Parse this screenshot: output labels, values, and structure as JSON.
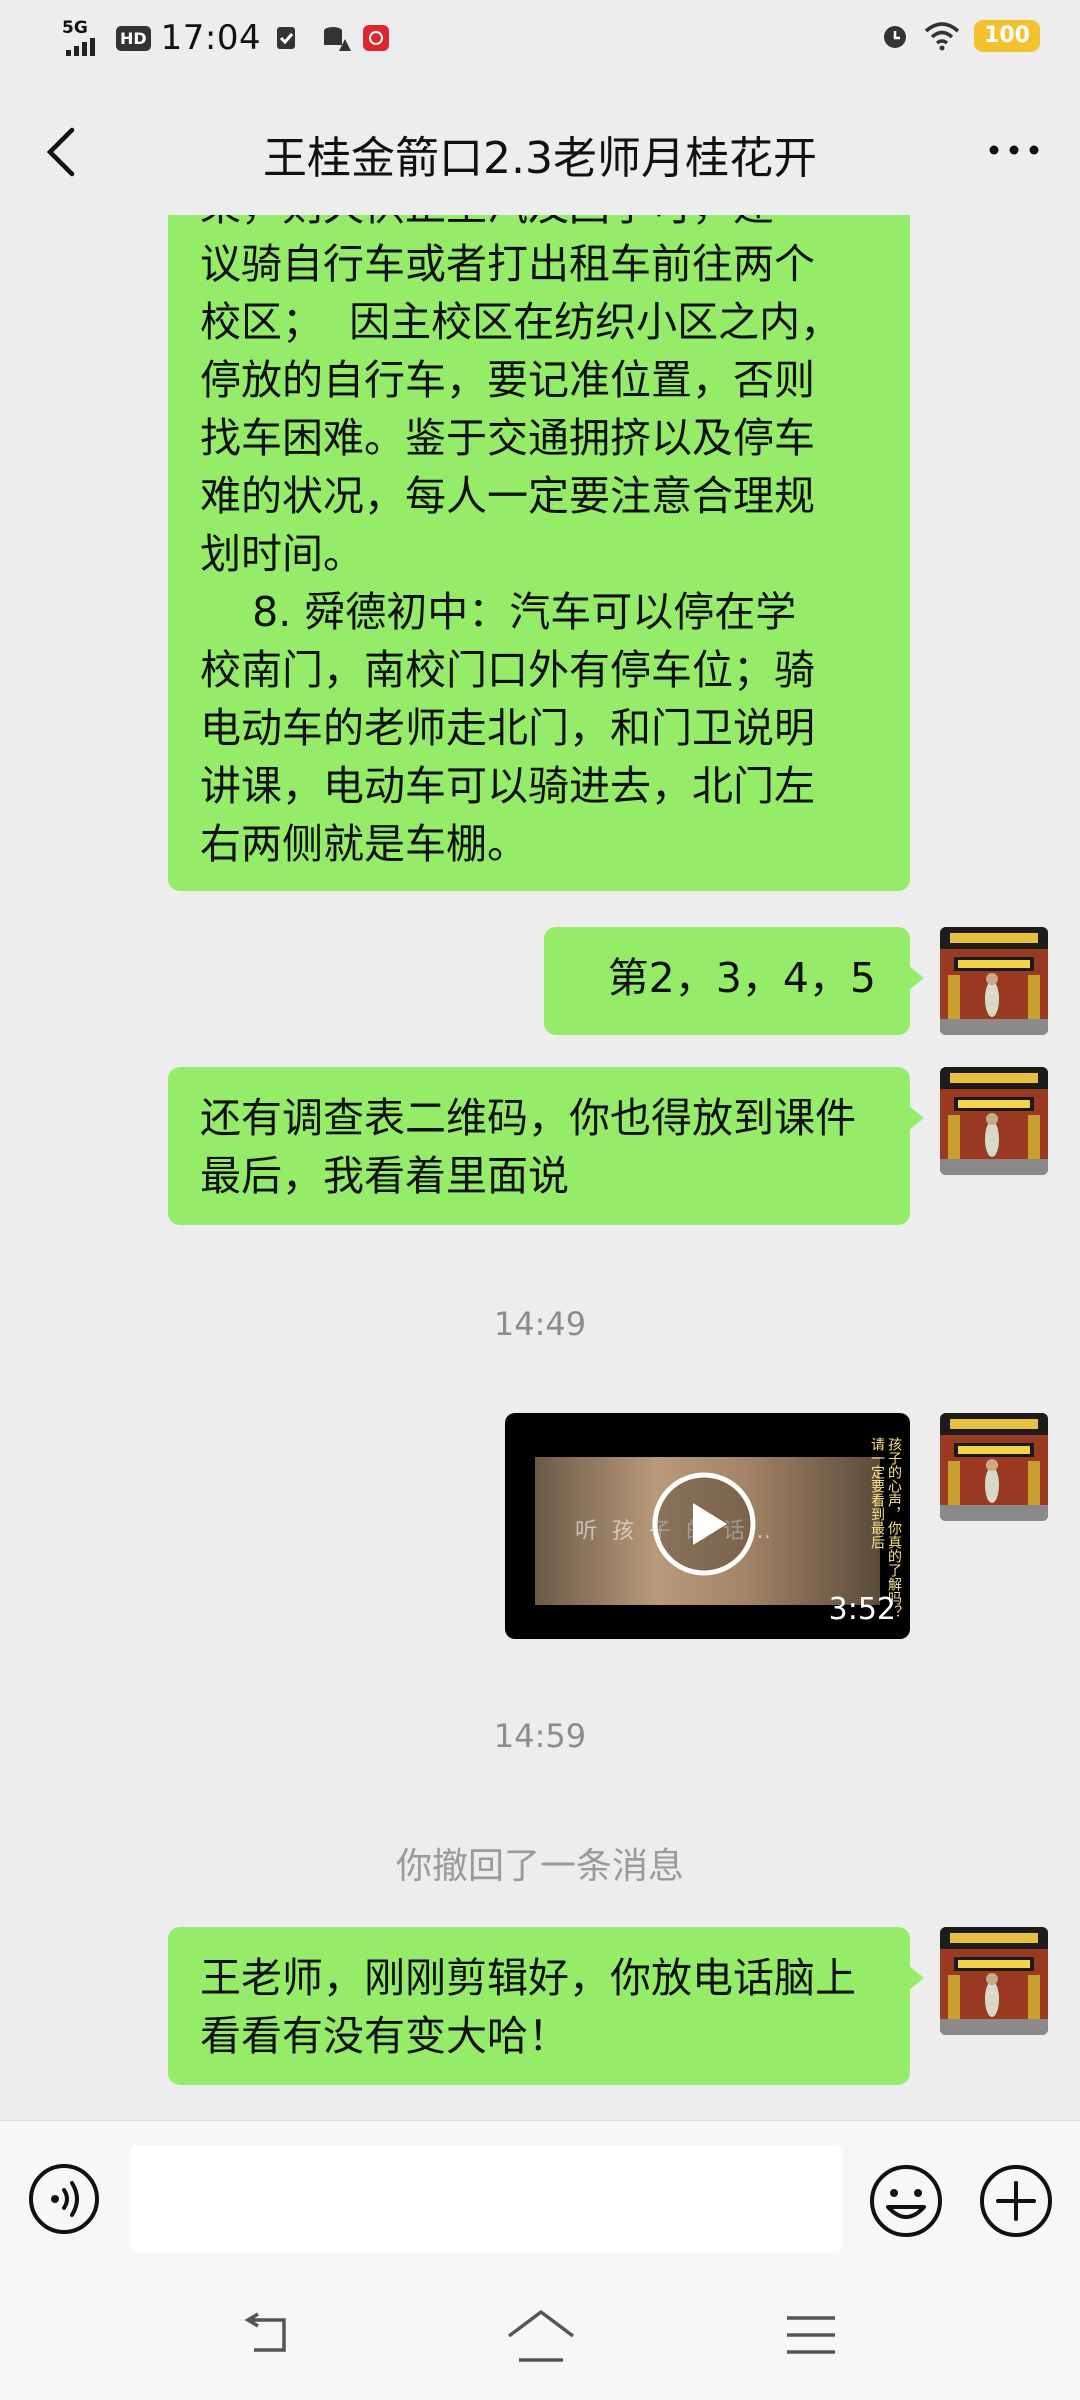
{
  "status_bar": {
    "network": "5G",
    "hd": "HD",
    "time": "17:04",
    "battery": "100",
    "icons": [
      "signal-5g-icon",
      "hd-icon",
      "check-shield-icon",
      "data-warning-icon",
      "app-badge-icon",
      "alarm-icon",
      "wifi-icon",
      "battery-icon"
    ]
  },
  "header": {
    "title": "王桂金箭口2.3老师月桂花开",
    "back_icon": "chevron-left-icon",
    "more_icon": "more-dots-icon"
  },
  "messages": [
    {
      "id": "msg1",
      "sender": "other",
      "text": "乘，则天供正坐汽及回学可，建\n议骑自行车或者打出租车前往两个\n校区；  因主校区在纺织小区之内，\n停放的自行车，要记准位置，否则\n找车困难。鉴于交通拥挤以及停车\n难的状况，每人一定要注意合理规\n划时间。\n    8. 舜德初中：汽车可以停在学\n校南门，南校门口外有停车位；骑\n电动车的老师走北门，和门卫说明\n讲课，电动车可以骑进去，北门左\n右两侧就是车棚。"
    },
    {
      "id": "msg2",
      "sender": "me",
      "text": "第2，3，4，5"
    },
    {
      "id": "msg3",
      "sender": "me",
      "text": "还有调查表二维码，你也得放到课件最后，我看着里面说"
    },
    {
      "id": "ts1",
      "type": "timestamp",
      "text": "14:49"
    },
    {
      "id": "video1",
      "type": "video",
      "sender": "me",
      "duration": "3:52",
      "overlay_text": "听 孩 子 的 话…",
      "side_text": "孩子的心声，你真的了解吗？请一定要看到最后"
    },
    {
      "id": "ts2",
      "type": "timestamp",
      "text": "14:59"
    },
    {
      "id": "sys1",
      "type": "system",
      "text": "你撤回了一条消息"
    },
    {
      "id": "msg4",
      "sender": "me",
      "text": "王老师，刚刚剪辑好，你放电话脑上看看有没有变大哈！"
    }
  ],
  "avatar": {
    "banner_text": "后街街道新文明",
    "banner_sub": "新时代文明大讲堂"
  },
  "input_bar": {
    "value": "",
    "voice_icon": "voice-icon",
    "emoji_icon": "emoji-icon",
    "add_icon": "plus-circle-icon"
  },
  "nav_bar": {
    "icons": [
      "nav-back-icon",
      "nav-home-icon",
      "nav-menu-icon"
    ]
  },
  "colors": {
    "bubble_green": "#95ec69",
    "background": "#ededed",
    "battery_yellow": "#f2c230"
  }
}
